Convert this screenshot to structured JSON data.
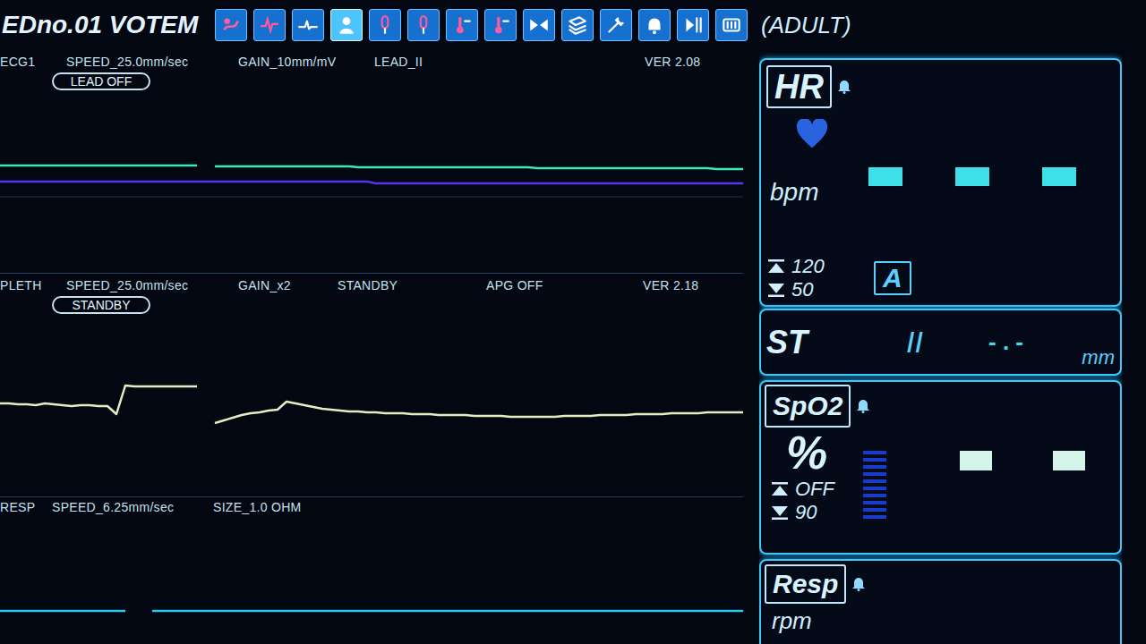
{
  "header": {
    "title": "EDno.01 VOTEM",
    "mode": "(ADULT)",
    "toolbar": [
      {
        "kind": "pin",
        "selected": false
      },
      {
        "kind": "ecg",
        "selected": false
      },
      {
        "kind": "wave",
        "selected": false
      },
      {
        "kind": "person",
        "selected": true
      },
      {
        "kind": "probe",
        "selected": false
      },
      {
        "kind": "probe",
        "selected": false
      },
      {
        "kind": "thermo",
        "selected": false
      },
      {
        "kind": "thermo",
        "selected": false
      },
      {
        "kind": "skip",
        "selected": false
      },
      {
        "kind": "layers",
        "selected": false
      },
      {
        "kind": "tool",
        "selected": false
      },
      {
        "kind": "bell",
        "selected": false
      },
      {
        "kind": "play",
        "selected": false
      },
      {
        "kind": "battery",
        "selected": false
      }
    ]
  },
  "waveforms": [
    {
      "name": "ECG1",
      "fields": [
        "SPEED_25.0mm/sec",
        "GAIN_10mm/mV",
        "LEAD_II",
        "VER 2.08"
      ],
      "badge": "LEAD OFF",
      "traces": [
        {
          "color": "#3fe6b4",
          "values": [
            0,
            0,
            0,
            0,
            0,
            0,
            0,
            0,
            0,
            0,
            0,
            0,
            0,
            0,
            0,
            0,
            0,
            0,
            0,
            0,
            0,
            0,
            0,
            null,
            -1,
            -1,
            -1,
            -1,
            -1,
            -1,
            -1,
            -1,
            -1,
            -1,
            -1,
            -1,
            -1,
            -1,
            -1,
            -1,
            -2,
            -2,
            -2,
            -2,
            -2,
            -2,
            -2,
            -2,
            -2,
            -2,
            -2,
            -2,
            -2,
            -2,
            -2,
            -2,
            -2,
            -2,
            -2,
            -2,
            -3,
            -3,
            -3,
            -3,
            -3,
            -3,
            -3,
            -3,
            -3,
            -3,
            -3,
            -3,
            -3,
            -3,
            -3,
            -3,
            -3,
            -3,
            -3,
            -3,
            -4,
            -4,
            -4,
            -4
          ]
        },
        {
          "color": "#5634ec",
          "values": [
            0,
            0,
            0,
            0,
            0,
            0,
            0,
            0,
            0,
            0,
            0,
            0,
            0,
            0,
            0,
            0,
            0,
            0,
            0,
            0,
            0,
            0,
            0,
            0,
            0,
            0,
            0,
            0,
            0,
            0,
            0,
            0,
            0,
            0,
            0,
            0,
            0,
            0,
            0,
            0,
            0,
            0,
            -2,
            -2,
            -2,
            -2,
            -2,
            -2,
            -2,
            -2,
            -2,
            -2,
            -2,
            -2,
            -2,
            -2,
            -2,
            -2,
            -2,
            -2,
            -2,
            -2,
            -2,
            -2,
            -2,
            -2,
            -2,
            -2,
            -2,
            -2,
            -2,
            -2,
            -2,
            -2,
            -2,
            -2,
            -2,
            -2,
            -2,
            -2,
            -2,
            -2,
            -2,
            -2
          ]
        }
      ]
    },
    {
      "name": "PLETH",
      "fields": [
        "SPEED_25.0mm/sec",
        "GAIN_x2",
        "STANDBY",
        "APG OFF",
        "VER 2.18"
      ],
      "badge": "STANDBY",
      "traces": [
        {
          "color": "#e6ecc2",
          "values": [
            5,
            5,
            4,
            4,
            3,
            5,
            4,
            3,
            2,
            3,
            3,
            2,
            2,
            -7,
            25,
            24,
            24,
            24,
            24,
            24,
            24,
            24,
            24,
            null,
            -17,
            -14,
            -11,
            -8,
            -6,
            -5,
            -3,
            -2,
            7,
            5,
            3,
            1,
            -1,
            -2,
            -3,
            -4,
            -4,
            -5,
            -5,
            -6,
            -6,
            -6,
            -7,
            -7,
            -7,
            -8,
            -8,
            -8,
            -8,
            -9,
            -9,
            -9,
            -9,
            -10,
            -10,
            -10,
            -10,
            -10,
            -10,
            -9,
            -9,
            -9,
            -9,
            -8,
            -8,
            -8,
            -8,
            -7,
            -7,
            -7,
            -7,
            -6,
            -6,
            -6,
            -6,
            -5,
            -5,
            -5,
            -5,
            -5
          ]
        }
      ]
    },
    {
      "name": "RESP",
      "fields": [
        "SPEED_6.25mm/sec",
        "SIZE_1.0 OHM"
      ],
      "traces": [
        {
          "color": "#2ec8ee",
          "values": [
            0,
            0,
            0,
            0,
            0,
            0,
            0,
            0,
            0,
            0,
            0,
            0,
            0,
            0,
            0,
            null,
            null,
            0,
            0,
            0,
            0,
            0,
            0,
            0,
            0,
            0,
            0,
            0,
            0,
            0,
            0,
            0,
            0,
            0,
            0,
            0,
            0,
            0,
            0,
            0,
            0,
            0,
            0,
            0,
            0,
            0,
            0,
            0,
            0,
            0,
            0,
            0,
            0,
            0,
            0,
            0,
            0,
            0,
            0,
            0,
            0,
            0,
            0,
            0,
            0,
            0,
            0,
            0,
            0,
            0,
            0,
            0,
            0,
            0,
            0,
            0,
            0,
            0,
            0,
            0,
            0,
            0,
            0,
            0
          ]
        }
      ]
    }
  ],
  "vitals": {
    "hr": {
      "label": "HR",
      "unit": "bpm",
      "dash_count": 3,
      "upper_limit": "120",
      "lower_limit": "50",
      "mode": "A",
      "alarm_on": true
    },
    "st": {
      "label": "ST",
      "lead": "II",
      "value": "- . -",
      "unit": "mm"
    },
    "spo2": {
      "label": "SpO2",
      "unit": "%",
      "upper_limit": "OFF",
      "lower_limit": "90",
      "dash_count": 2,
      "level": 0,
      "alarm_on": true
    },
    "resp": {
      "label": "Resp",
      "unit": "rpm",
      "alarm_on": true
    }
  }
}
